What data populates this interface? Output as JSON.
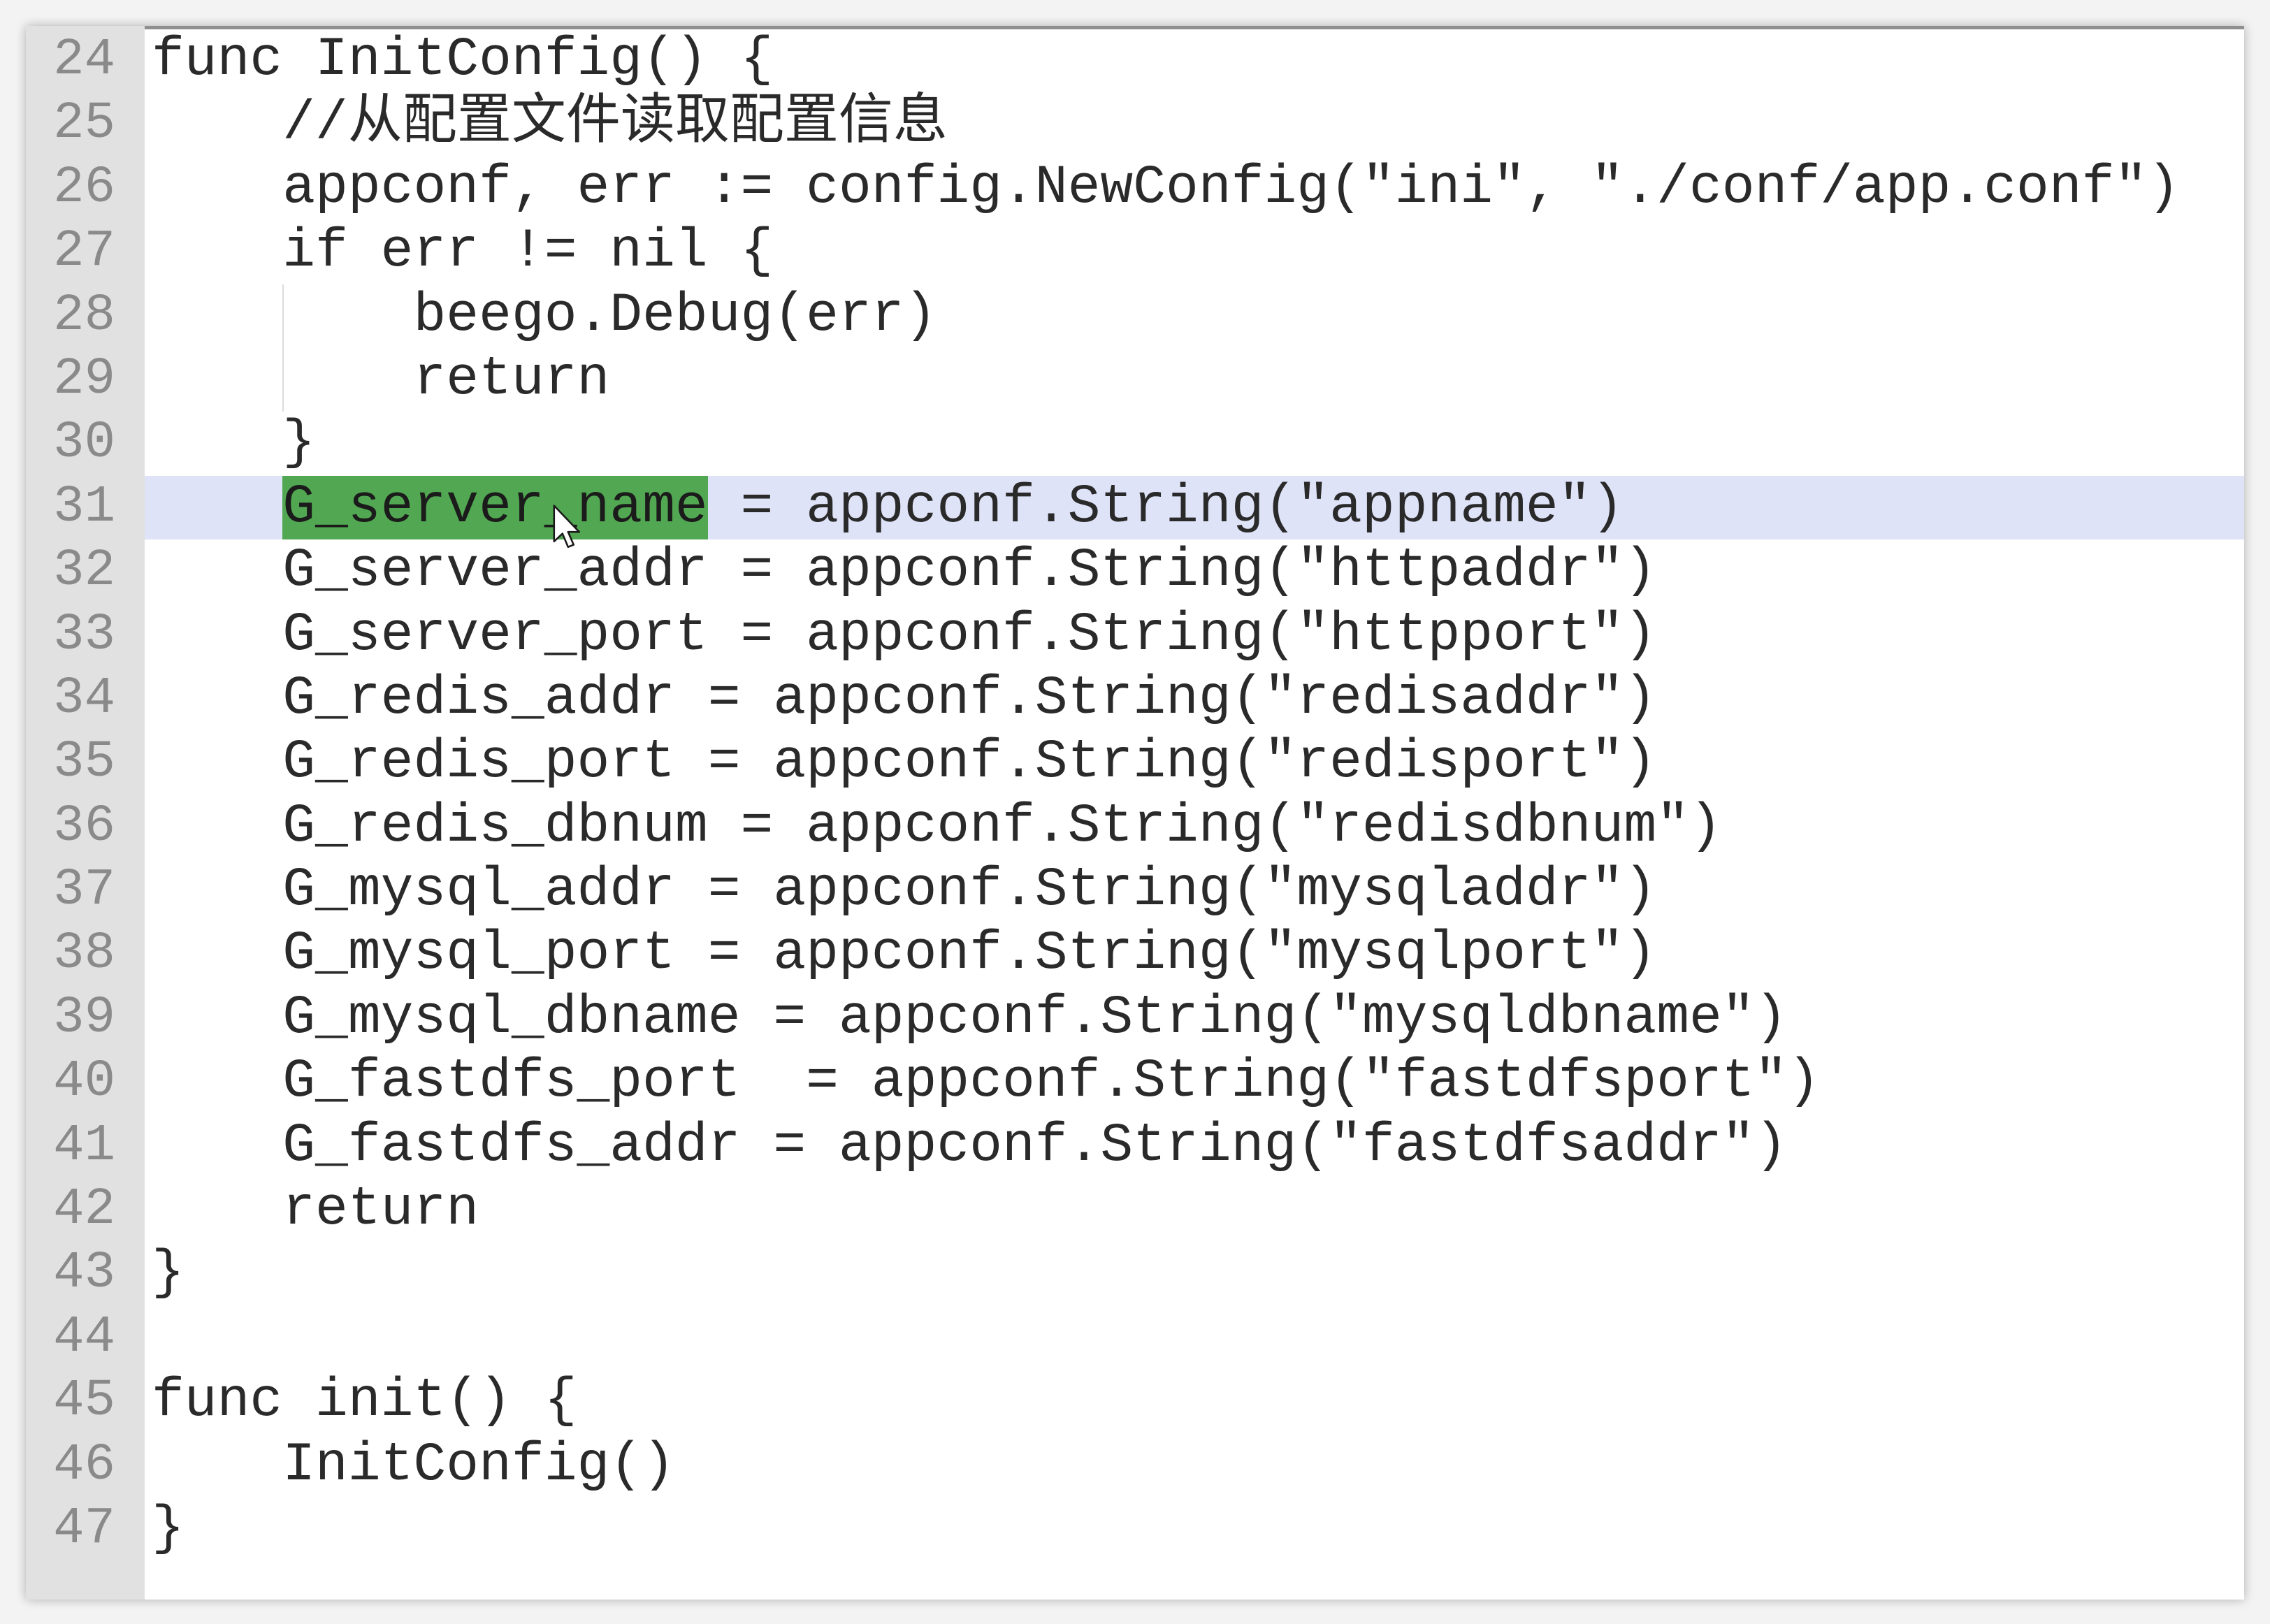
{
  "editor": {
    "lines": [
      {
        "number": "24",
        "text": "func InitConfig() {"
      },
      {
        "number": "25",
        "text": "    //从配置文件读取配置信息"
      },
      {
        "number": "26",
        "text": "    appconf, err := config.NewConfig(\"ini\", \"./conf/app.conf\")"
      },
      {
        "number": "27",
        "text": "    if err != nil {"
      },
      {
        "number": "28",
        "text": "        beego.Debug(err)"
      },
      {
        "number": "29",
        "text": "        return"
      },
      {
        "number": "30",
        "text": "    }"
      },
      {
        "number": "31",
        "before": "    ",
        "selected": "G_server_name",
        "after": " = appconf.String(\"appname\")"
      },
      {
        "number": "32",
        "text": "    G_server_addr = appconf.String(\"httpaddr\")"
      },
      {
        "number": "33",
        "text": "    G_server_port = appconf.String(\"httpport\")"
      },
      {
        "number": "34",
        "text": "    G_redis_addr = appconf.String(\"redisaddr\")"
      },
      {
        "number": "35",
        "text": "    G_redis_port = appconf.String(\"redisport\")"
      },
      {
        "number": "36",
        "text": "    G_redis_dbnum = appconf.String(\"redisdbnum\")"
      },
      {
        "number": "37",
        "text": "    G_mysql_addr = appconf.String(\"mysqladdr\")"
      },
      {
        "number": "38",
        "text": "    G_mysql_port = appconf.String(\"mysqlport\")"
      },
      {
        "number": "39",
        "text": "    G_mysql_dbname = appconf.String(\"mysqldbname\")"
      },
      {
        "number": "40",
        "text": "    G_fastdfs_port  = appconf.String(\"fastdfsport\")"
      },
      {
        "number": "41",
        "text": "    G_fastdfs_addr = appconf.String(\"fastdfsaddr\")"
      },
      {
        "number": "42",
        "text": "    return"
      },
      {
        "number": "43",
        "text": "}"
      },
      {
        "number": "44",
        "text": ""
      },
      {
        "number": "45",
        "text": "func init() {"
      },
      {
        "number": "46",
        "text": "    InitConfig()"
      },
      {
        "number": "47",
        "text": "}"
      }
    ]
  },
  "colors": {
    "page_bg": "#f3f3f3",
    "gutter": "#e1e1e1",
    "current_line": "#dfe3f7",
    "selection": "#52a852",
    "text": "#2a2a2a",
    "line_number": "#8a8a8a"
  },
  "icons": {
    "pointer": "mouse-pointer-icon"
  }
}
